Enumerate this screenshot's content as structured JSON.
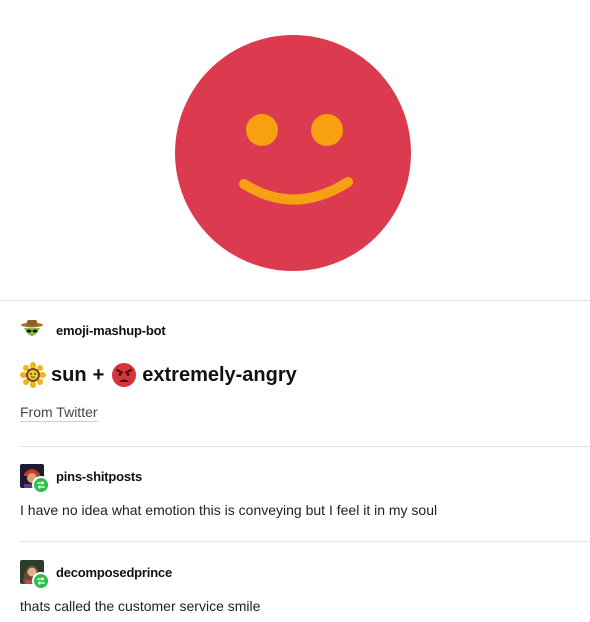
{
  "colors": {
    "face": "#dc3b4f",
    "features": "#f6a012",
    "divider": "#e4e4e4",
    "reblog_badge": "#2fbf4e"
  },
  "hero": {
    "icon": "red-smiley-face-icon"
  },
  "posts": [
    {
      "username": "emoji-mashup-bot",
      "avatar_icon": "alien-cowboy-avatar-icon",
      "mashup": {
        "first_icon": "sun-flower-icon",
        "first": "sun",
        "plus": "+",
        "second_icon": "extremely-angry-face-icon",
        "second": "extremely-angry"
      },
      "source": "From Twitter"
    },
    {
      "username": "pins-shitposts",
      "avatar_icon": "user-avatar-icon",
      "badge_icon": "reblog-icon",
      "text": "I have no idea what emotion this is conveying but I feel it in my soul"
    },
    {
      "username": "decomposedprince",
      "avatar_icon": "user-avatar-icon",
      "badge_icon": "reblog-icon",
      "text": "thats called the customer service smile"
    }
  ]
}
